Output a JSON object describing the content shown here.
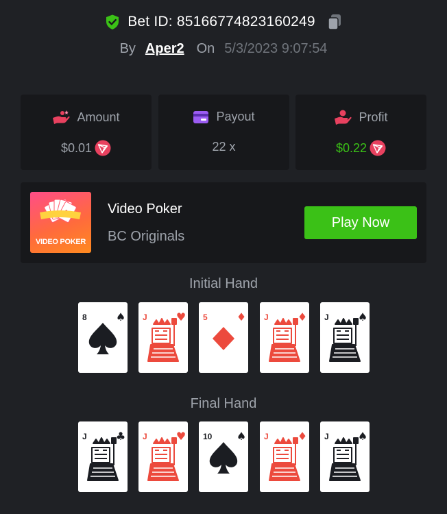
{
  "bet": {
    "label": "Bet ID: 85166774823160249",
    "by_label": "By",
    "user": "Aper2",
    "on_label": "On",
    "date": "5/3/2023 9:07:54"
  },
  "stats": {
    "amount": {
      "title": "Amount",
      "value": "$0.01",
      "icon": "hand-coins-icon"
    },
    "payout": {
      "title": "Payout",
      "value": "22 x",
      "icon": "card-icon"
    },
    "profit": {
      "title": "Profit",
      "value": "$0.22",
      "icon": "hand-money-icon"
    }
  },
  "game": {
    "thumb_text": "VIDEO POKER",
    "name": "Video Poker",
    "provider": "BC Originals",
    "play_label": "Play Now"
  },
  "hands": {
    "initial_title": "Initial Hand",
    "final_title": "Final Hand",
    "initial": [
      {
        "rank": "8",
        "suit": "spades"
      },
      {
        "rank": "J",
        "suit": "hearts"
      },
      {
        "rank": "5",
        "suit": "diamonds"
      },
      {
        "rank": "J",
        "suit": "diamonds"
      },
      {
        "rank": "J",
        "suit": "spades"
      }
    ],
    "final": [
      {
        "rank": "J",
        "suit": "clubs"
      },
      {
        "rank": "J",
        "suit": "hearts"
      },
      {
        "rank": "10",
        "suit": "spades"
      },
      {
        "rank": "J",
        "suit": "diamonds"
      },
      {
        "rank": "J",
        "suit": "spades"
      }
    ]
  },
  "colors": {
    "background": "#1f2125",
    "panel": "#17181b",
    "accent_green": "#3bc117",
    "muted_text": "#9ea3ab",
    "card_red": "#ec4a3d",
    "card_black": "#1b1d22",
    "coin": "#e8415f"
  }
}
